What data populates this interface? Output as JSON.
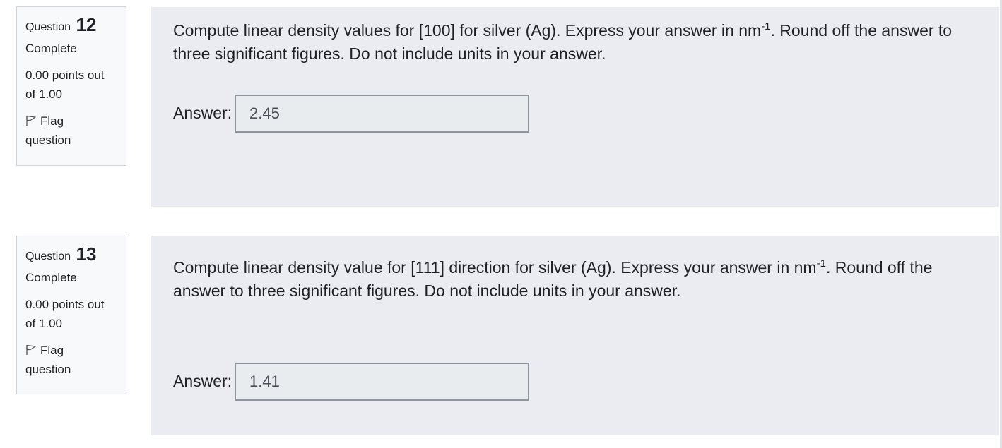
{
  "questions": [
    {
      "label": "Question",
      "number": "12",
      "state": "Complete",
      "grade": "0.00 points out of 1.00",
      "flag_label": "Flag question",
      "text_before_sup": "Compute linear density values for [100] for silver (Ag). Express your answer in nm",
      "text_sup": "-1",
      "text_after_sup": ". Round off the answer to three significant figures. Do not include units in your answer.",
      "answer_label": "Answer:",
      "answer_value": "2.45"
    },
    {
      "label": "Question",
      "number": "13",
      "state": "Complete",
      "grade": "0.00 points out of 1.00",
      "flag_label": "Flag question",
      "text_before_sup": "Compute linear density value for [111] direction for silver (Ag). Express your answer in nm",
      "text_sup": "-1",
      "text_after_sup": ". Round off the answer to three significant figures. Do not include units in your answer.",
      "answer_label": "Answer:",
      "answer_value": "1.41"
    }
  ],
  "colors": {
    "info_background": "#f8f9fa",
    "info_border": "#cfd4da",
    "content_background": "#eaecf1",
    "input_background": "#e9ecef",
    "input_border": "#8f959e"
  }
}
